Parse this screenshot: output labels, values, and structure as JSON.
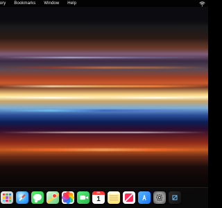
{
  "menubar": {
    "items": [
      {
        "label": "tory"
      },
      {
        "label": "Bookmarks"
      },
      {
        "label": "Window"
      },
      {
        "label": "Help"
      }
    ],
    "status_icons": [
      {
        "name": "wifi-icon"
      }
    ]
  },
  "wallpaper": {
    "description_colors": [
      "#0b0b10",
      "#f5cf7f",
      "#7caed6",
      "#0b1f55",
      "#c35a20",
      "#050505"
    ]
  },
  "dock": {
    "apps": [
      {
        "name": "launchpad-icon",
        "running": true
      },
      {
        "name": "safari-icon",
        "running": true
      },
      {
        "name": "messages-icon",
        "running": false
      },
      {
        "name": "maps-icon",
        "running": false
      },
      {
        "name": "photos-icon",
        "running": false
      },
      {
        "name": "facetime-icon",
        "running": false
      },
      {
        "name": "calendar-icon",
        "running": false,
        "month": "JUL",
        "day": "1"
      },
      {
        "name": "notes-icon",
        "running": false
      },
      {
        "name": "news-icon",
        "running": false
      },
      {
        "name": "app-store-icon",
        "running": false
      },
      {
        "name": "system-settings-icon",
        "running": false
      },
      {
        "name": "app-icon",
        "running": false
      }
    ]
  }
}
